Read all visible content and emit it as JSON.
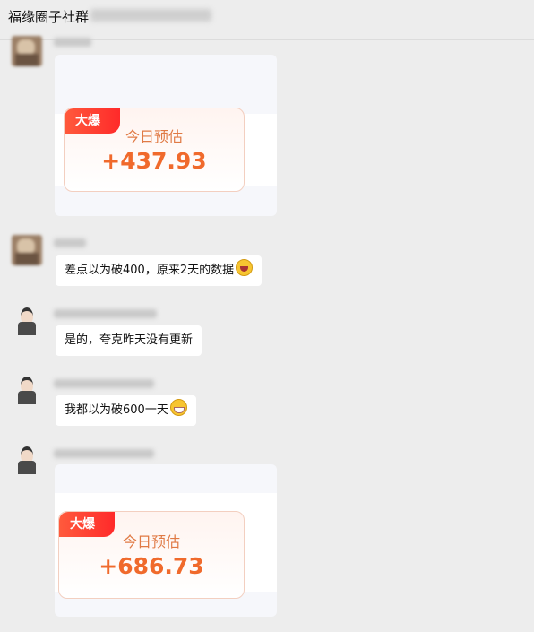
{
  "header": {
    "title": "福缘圈子社群"
  },
  "messages": [
    {
      "type": "card",
      "tag": "大爆",
      "label": "今日预估",
      "value": "+437.93"
    },
    {
      "type": "text",
      "text": "差点以为破400，原来2天的数据",
      "emoji": "laughing-tears-emoji"
    },
    {
      "type": "text",
      "text": "是的，夸克昨天没有更新"
    },
    {
      "type": "text",
      "text": "我都以为破600一天",
      "emoji": "grinning-emoji"
    },
    {
      "type": "card",
      "tag": "大爆",
      "label": "今日预估",
      "value": "+686.73"
    }
  ]
}
